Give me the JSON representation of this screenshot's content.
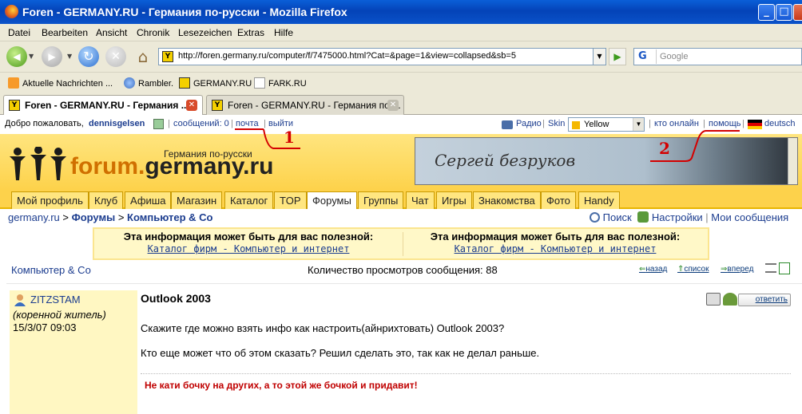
{
  "window": {
    "title": "Foren - GERMANY.RU - Германия по-русски - Mozilla Firefox",
    "min": "_",
    "max": "□",
    "close": "X"
  },
  "menu": [
    "Datei",
    "Bearbeiten",
    "Ansicht",
    "Chronik",
    "Lesezeichen",
    "Extras",
    "Hilfe"
  ],
  "urlbar": {
    "url": "http://foren.germany.ru/computer/f/7475000.html?Cat=&page=1&view=collapsed&sb=5",
    "favicon": "Y"
  },
  "search": {
    "engine": "G",
    "placeholder": "Google"
  },
  "bookmarks": [
    "Aktuelle Nachrichten ...",
    "Rambler.",
    "GERMANY.RU",
    "FARK.RU"
  ],
  "tabs": [
    {
      "label": "Foren - GERMANY.RU - Германия ...",
      "active": true
    },
    {
      "label": "Foren - GERMANY.RU - Германия по-...",
      "active": false
    }
  ],
  "topline": {
    "welcome": "Добро пожаловать,",
    "user": "dennisgelsen",
    "messages": "сообщений: 0",
    "mail": "почта",
    "logout": "выйти",
    "radio": "Радио",
    "skin_label": "Skin",
    "skin_value": "Yellow",
    "online": "кто онлайн",
    "help": "помощь",
    "lang": "deutsch"
  },
  "logo": {
    "sub": "Германия по-русски",
    "part1": "forum.",
    "part2": "germany.ru"
  },
  "banner": {
    "text": "Сергей безруков"
  },
  "navtabs": [
    "Мой профиль",
    "Клуб",
    "Афиша",
    "Магазин",
    "Каталог",
    "TOP",
    "Форумы",
    "Группы",
    "Чат",
    "Игры",
    "Знакомства",
    "Фото",
    "Handy"
  ],
  "breadcrumb": {
    "root": "germany.ru",
    "sep": " > ",
    "forums": "Форумы",
    "current": "Компьютер & Co"
  },
  "tools": {
    "search": "Поиск",
    "settings": "Настройки",
    "mymsg": "Мои сообщения",
    "sep": "|"
  },
  "info": {
    "heading": "Эта информация может быть для вас полезной:",
    "link": "Каталог фирм - Компьютер и интернет"
  },
  "forum_name": "Компьютер & Co",
  "views": "Количество просмотров сообщения: 88",
  "pager": {
    "back": "назад",
    "list": "список",
    "next": "вперед"
  },
  "post": {
    "author": "ZITZSTAM",
    "rank": "(коренной житель)",
    "date": "15/3/07 09:03",
    "title": "Outlook 2003",
    "line1": "Скажите где можно взять инфо как настроить(айнрихтовать) Outlook 2003?",
    "line2": "Кто еще может что об этом сказать? Решил сделать это, так как не делал раньше.",
    "signature": "Не кати бочку на других, а то этой же бочкой и придавит!",
    "reply": "ответить"
  },
  "annotations": {
    "mark1": "1",
    "mark2": "2",
    "color": "#d40000"
  }
}
